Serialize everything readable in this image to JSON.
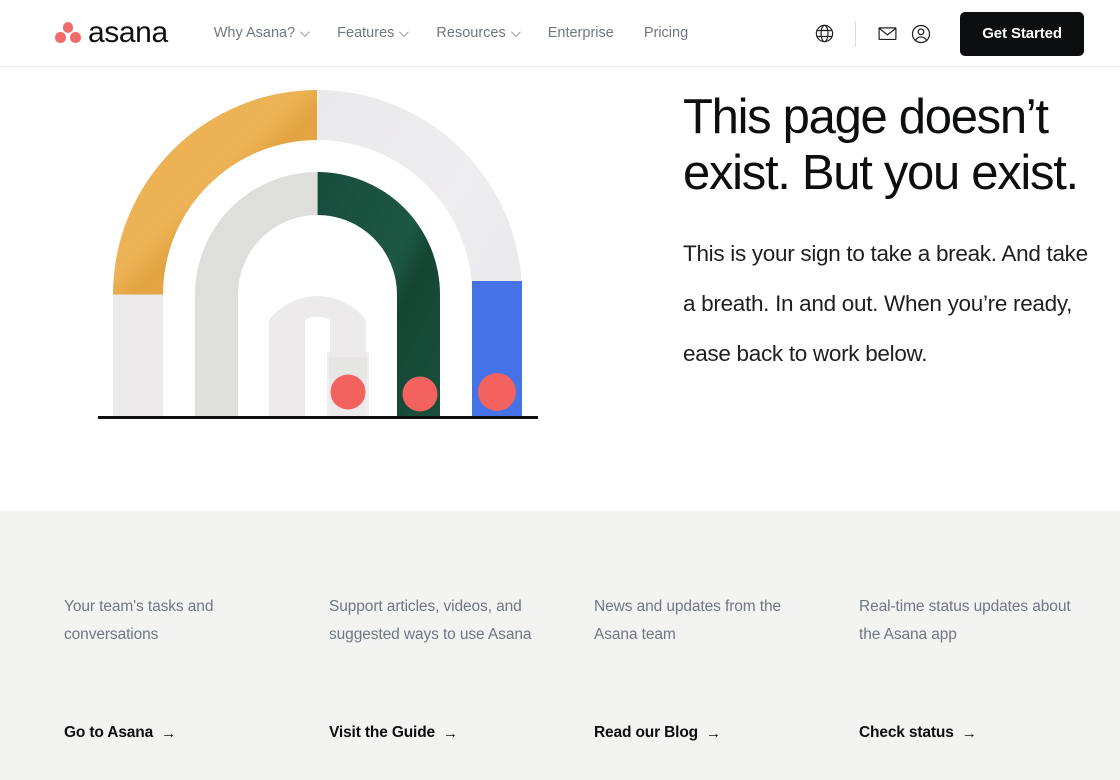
{
  "header": {
    "brand": {
      "name": "asana",
      "logo_icon": "asana-dots-logo",
      "dot_color": "#f06a6a"
    },
    "nav": [
      {
        "label": "Why Asana?",
        "has_caret": true
      },
      {
        "label": "Features",
        "has_caret": true
      },
      {
        "label": "Resources",
        "has_caret": true
      },
      {
        "label": "Enterprise",
        "has_caret": false
      },
      {
        "label": "Pricing",
        "has_caret": false
      }
    ],
    "icons": [
      {
        "name": "globe-icon",
        "title": "Language"
      },
      {
        "name": "envelope-icon",
        "title": "Contact"
      },
      {
        "name": "account-circle-icon",
        "title": "Account"
      }
    ],
    "cta": {
      "label": "Get Started",
      "bg": "#0d0e10",
      "color": "#ffffff"
    }
  },
  "hero": {
    "title": "This page doesn’t exist. But you exist.",
    "subtitle": "This is your sign to take a break. And take a breath. In and out. When you’re ready, ease back to work below.",
    "illustration": {
      "name": "nested-arches-illustration",
      "colors": {
        "amber": "#e8ab45",
        "light_gray": "#e7e6e5",
        "pale_gray": "#ededed",
        "mid_gray": "#dedede",
        "green": "#14503c",
        "blue": "#4573e7",
        "red_dot": "#f4625f",
        "baseline": "#0d0e10"
      },
      "dots": 3
    }
  },
  "footer": {
    "columns": [
      {
        "description": "Your team's tasks and conversations",
        "link": "Go to Asana",
        "arrow": "→"
      },
      {
        "description": "Support articles, videos, and suggested ways to use Asana",
        "link": "Visit the Guide",
        "arrow": "→"
      },
      {
        "description": "News and updates from the Asana team",
        "link": "Read our Blog",
        "arrow": "→"
      },
      {
        "description": "Real-time status updates about the Asana app",
        "link": "Check status",
        "arrow": "→"
      }
    ],
    "bg": "#f3f3f2"
  }
}
